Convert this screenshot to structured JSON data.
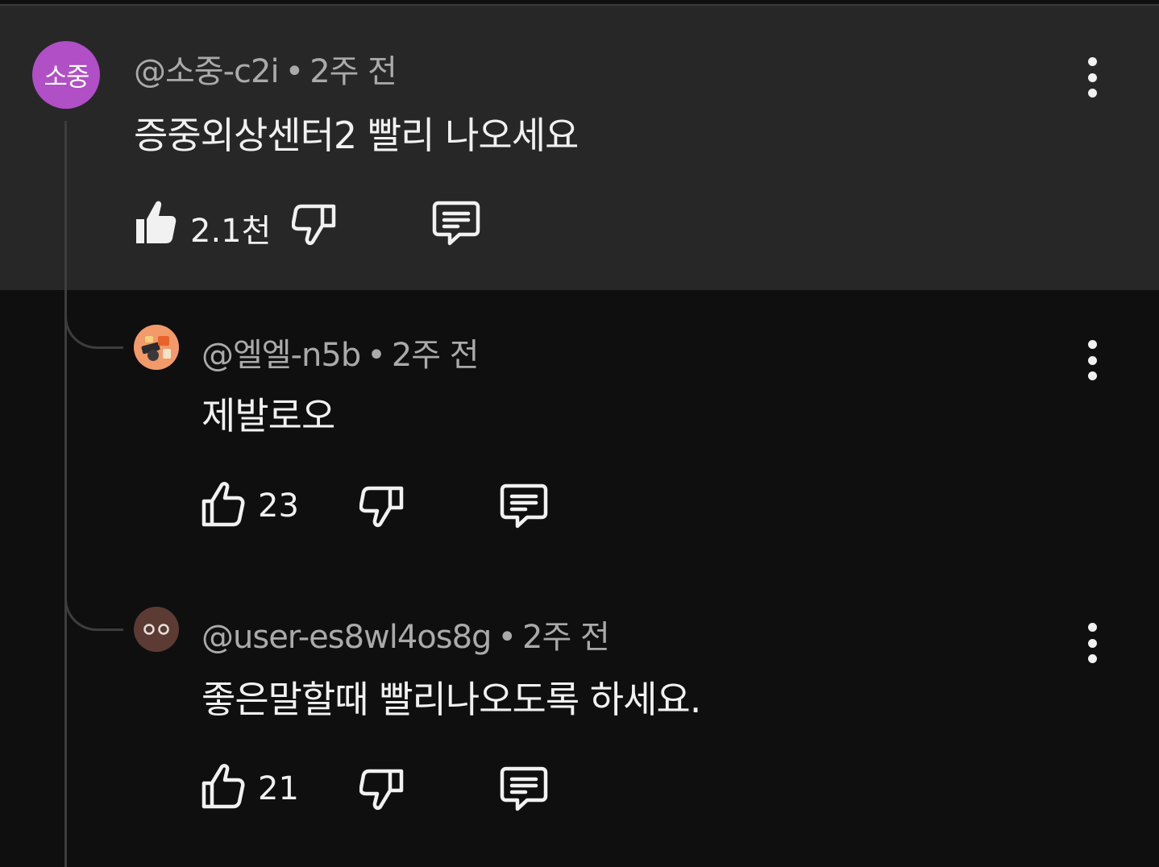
{
  "comments": [
    {
      "avatar_text": "소중",
      "avatar_color": "#b04fc6",
      "handle": "@소중-c2i",
      "time": "2주 전",
      "body": "증중외상센터2 빨리 나오세요",
      "likes": "2.1천",
      "liked": true,
      "highlighted": true
    },
    {
      "avatar_text": "",
      "avatar_color": "#f29a6a",
      "handle": "@엘엘-n5b",
      "time": "2주 전",
      "body": "제발로오",
      "likes": "23",
      "liked": false
    },
    {
      "avatar_text": "",
      "avatar_color": "#5b3b33",
      "handle": "@user-es8wl4os8g",
      "time": "2주 전",
      "body": "좋은말할때 빨리나오도록 하세요.",
      "likes": "21",
      "liked": false
    }
  ],
  "separator": "•",
  "icons": {
    "like": "thumbs-up-icon",
    "dislike": "thumbs-down-icon",
    "reply": "reply-icon",
    "more": "more-vertical-icon"
  }
}
